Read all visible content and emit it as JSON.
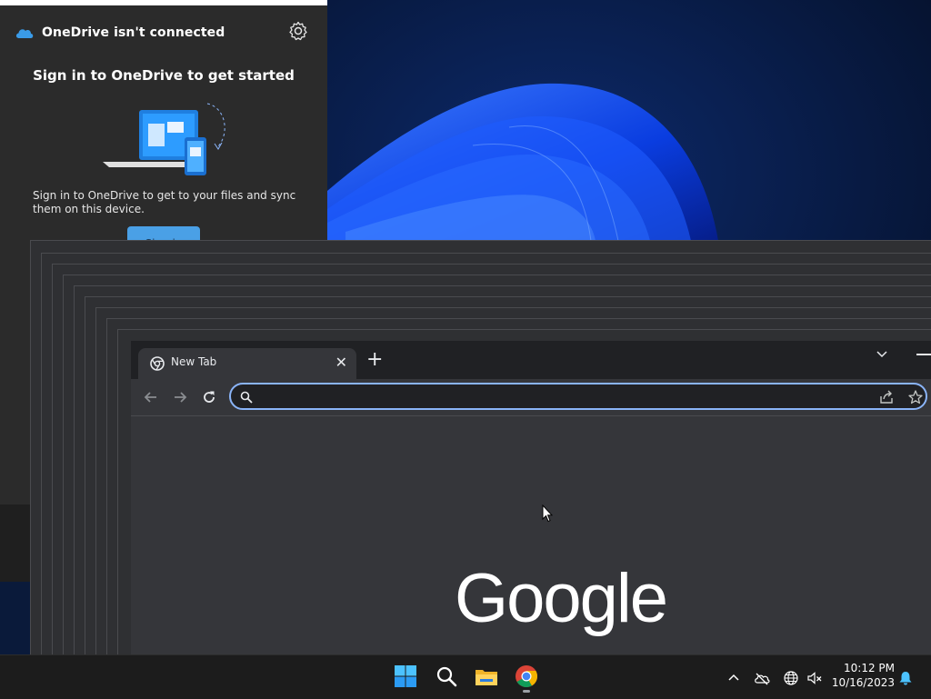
{
  "onedrive": {
    "title": "OneDrive isn't connected",
    "heading": "Sign in to OneDrive to get started",
    "description": "Sign in to OneDrive to get to your files and sync them on this device.",
    "signin_label": "Sign in"
  },
  "chrome": {
    "tab_title": "New Tab",
    "tab_close": "✕",
    "new_tab": "+",
    "omnibox_value": "",
    "logo_text": "Google"
  },
  "taskbar": {
    "time": "10:12 PM",
    "date": "10/16/2023",
    "icons": [
      "start-icon",
      "search-icon",
      "file-explorer-icon",
      "chrome-icon"
    ],
    "tray_icons": [
      "show-hidden-icons-chevron-icon",
      "onedrive-offline-icon",
      "network-icon",
      "volume-muted-icon",
      "notification-bell-icon"
    ]
  },
  "colors": {
    "accent": "#8ab4f8",
    "onedrive_blue": "#4aa0e6",
    "taskbar_bg": "#1c1c1c",
    "chrome_bg": "#35363a"
  }
}
